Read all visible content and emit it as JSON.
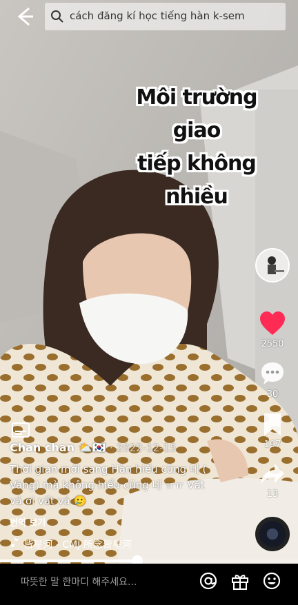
{
  "search": {
    "query": "cách đăng kí học tiếng hàn k-sem"
  },
  "overlay": {
    "lines": [
      "Môi trường giao",
      "tiếp không nhiều"
    ]
  },
  "actions": {
    "likes": "2550",
    "comments": "30",
    "saves": "197",
    "shares": "13"
  },
  "post": {
    "author": "Chan chan",
    "author_emojis": "⛅🇰🇷",
    "date": "· 2022-12-15",
    "description": "Thời gian mới sang Hàn hiểu cũng 네 ( Vâng) mà không hiểu cũng 네 ㅠㅠ Vất vả ơi vất vả 🥲",
    "translate": "번역 보기",
    "music": "皆星河 - CMJ    所念皆星河"
  },
  "progress": {
    "fraction": 0.46
  },
  "bottom": {
    "comment_placeholder": "따뜻한 말 한마디 해주세요..."
  },
  "icons": {
    "back": "back-arrow-icon",
    "search": "search-icon",
    "like": "heart-icon",
    "comment": "comment-icon",
    "save": "bookmark-icon",
    "share": "share-icon",
    "caption": "captions-icon",
    "music": "music-note-icon",
    "mention": "at-icon",
    "gift": "gift-icon",
    "emoji": "emoji-icon"
  },
  "colors": {
    "like": "#fe2c55",
    "bg": "#000000"
  }
}
